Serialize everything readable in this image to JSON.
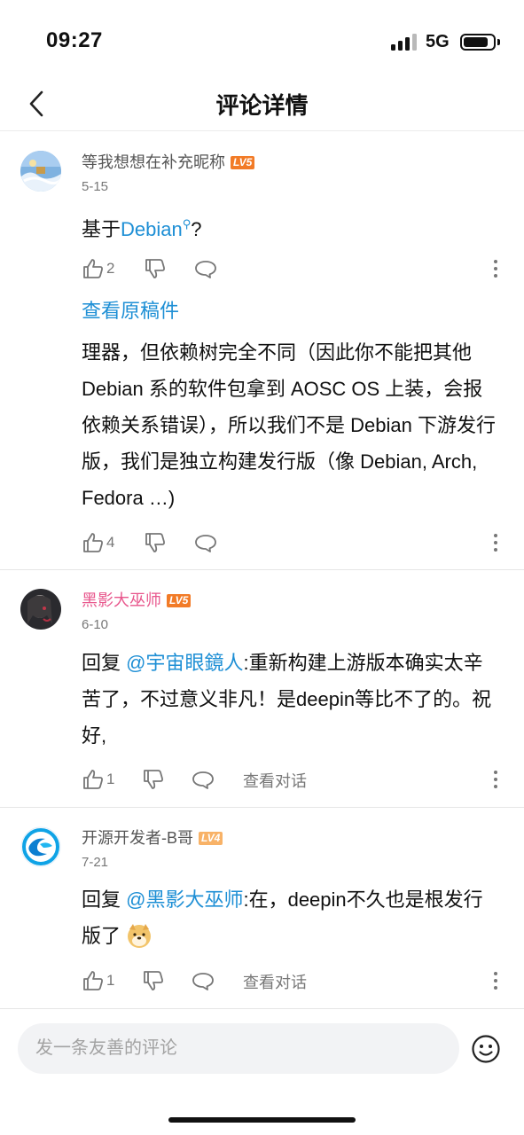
{
  "status_bar": {
    "time": "09:27",
    "network": "5G",
    "battery_level": 0.85
  },
  "nav": {
    "title": "评论详情"
  },
  "comments": [
    {
      "username": "等我想想在补充昵称",
      "level": "LV5",
      "date": "5-15",
      "text_prefix": "基于",
      "text_link": "Debian",
      "text_suffix": "?",
      "likes": "2",
      "view_original": "查看原稿件",
      "body": "理器，但依赖树完全不同（因此你不能把其他 Debian 系的软件包拿到 AOSC OS 上装，会报依赖关系错误），所以我们不是 Debian 下游发行版，我们是独立构建发行版（像 Debian, Arch, Fedora …)",
      "body_likes": "4"
    },
    {
      "username": "黑影大巫师",
      "level": "LV5",
      "date": "6-10",
      "reply_prefix": "回复 ",
      "mention": "@宇宙眼鏡人",
      "text": ":重新构建上游版本确实太辛苦了，不过意义非凡！是deepin等比不了的。祝好,",
      "likes": "1",
      "dialog_label": "查看对话"
    },
    {
      "username": "开源开发者-B哥",
      "level": "LV4",
      "date": "7-21",
      "reply_prefix": "回复 ",
      "mention": "@黑影大巫师",
      "text": ":在，deepin不久也是根发行版了",
      "likes": "1",
      "dialog_label": "查看对话"
    }
  ],
  "input": {
    "placeholder": "发一条友善的评论"
  },
  "colors": {
    "link": "#1e8fd5",
    "pink_name": "#e8568c",
    "lv5": "#f27b27",
    "lv4": "#f8b267"
  }
}
